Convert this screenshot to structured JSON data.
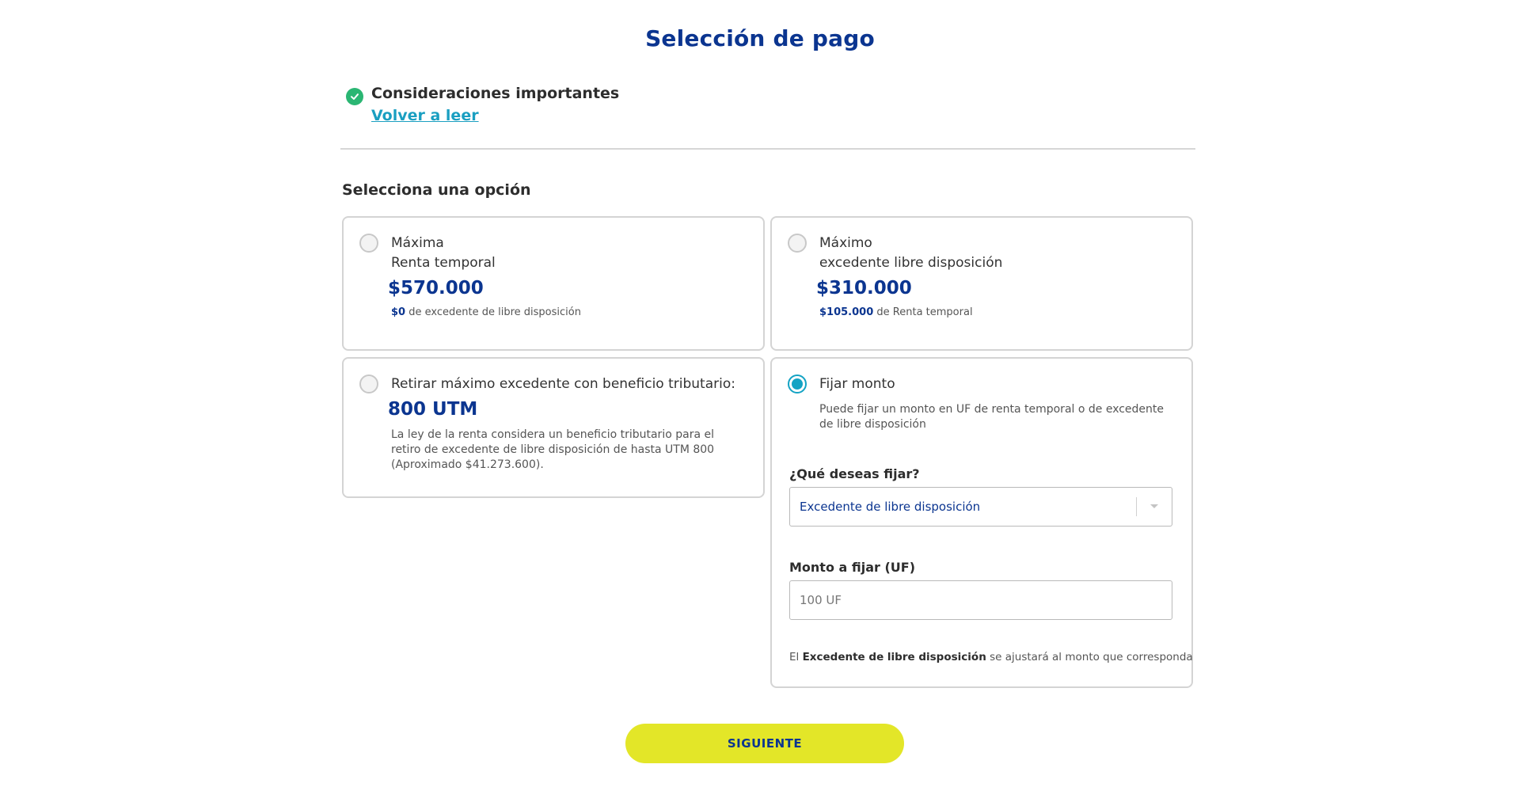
{
  "page": {
    "title": "Selección de pago"
  },
  "considerations": {
    "title": "Consideraciones importantes",
    "link": "Volver a leer",
    "status_icon": "check-circle-icon",
    "status_color": "#2bb673"
  },
  "section": {
    "label": "Selecciona una opción"
  },
  "options": [
    {
      "line1": "Máxima",
      "line2": "Renta temporal",
      "amount": "$570.000",
      "note_value": "$0",
      "note_text": "de excedente de libre disposición",
      "selected": false
    },
    {
      "line1": "Máximo",
      "line2": "excedente libre disposición",
      "amount": "$310.000",
      "note_value": "$105.000",
      "note_text": "de Renta temporal",
      "selected": false
    },
    {
      "line1": "Retirar máximo excedente con beneficio tributario:",
      "amount": "800 UTM",
      "description": "La ley de la renta considera un beneficio tributario para el retiro de excedente de libre disposición de hasta UTM 800 (Aproximado $41.273.600).",
      "selected": false
    },
    {
      "line1": "Fijar monto",
      "description": "Puede fijar un monto en UF de renta temporal o de excedente de libre disposición",
      "selected": true
    }
  ],
  "fix_form": {
    "what_label": "¿Qué deseas fijar?",
    "what_value": "Excedente de libre disposición",
    "amount_label": "Monto a fijar (UF)",
    "amount_placeholder": "100 UF",
    "hint_prefix": "El",
    "hint_bold": "Excedente de libre disposición",
    "hint_suffix": "se ajustará al monto que corresponda"
  },
  "actions": {
    "next_label": "SIGUIENTE"
  },
  "colors": {
    "brand_blue": "#0b3590",
    "accent_cyan": "#14a3c4",
    "button_yellow": "#e3e628",
    "success_green": "#2bb673"
  }
}
